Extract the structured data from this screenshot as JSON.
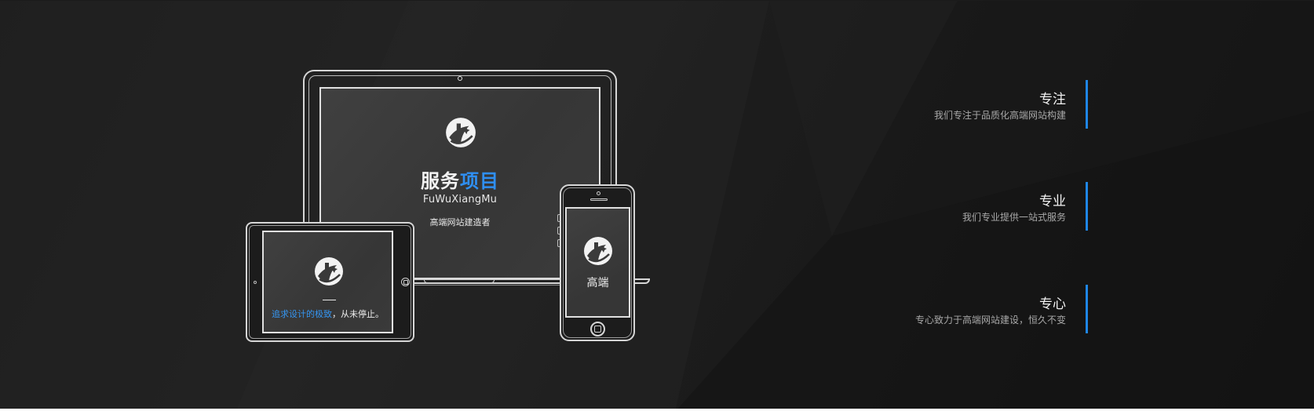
{
  "colors": {
    "background": "#1b1b1b",
    "accent": "#1f86e6",
    "device_outline": "#d6d6d6",
    "screen": "#3a3a3a"
  },
  "laptop": {
    "logo_icon": "brand-logo-icon",
    "title_white": "服务",
    "title_blue": "项目",
    "subtitle": "FuWuXiangMu",
    "tagline": "高端网站建造者"
  },
  "tablet": {
    "logo_icon": "brand-logo-icon",
    "dash": "—",
    "text_blue": "追求设计的极致",
    "text_white": "，从未停止。"
  },
  "phone": {
    "logo_icon": "brand-logo-icon",
    "text": "高端"
  },
  "features": [
    {
      "title": "专注",
      "desc": "我们专注于品质化高端网站构建"
    },
    {
      "title": "专业",
      "desc": "我们专业提供一站式服务"
    },
    {
      "title": "专心",
      "desc": "专心致力于高端网站建设，恒久不变"
    }
  ]
}
